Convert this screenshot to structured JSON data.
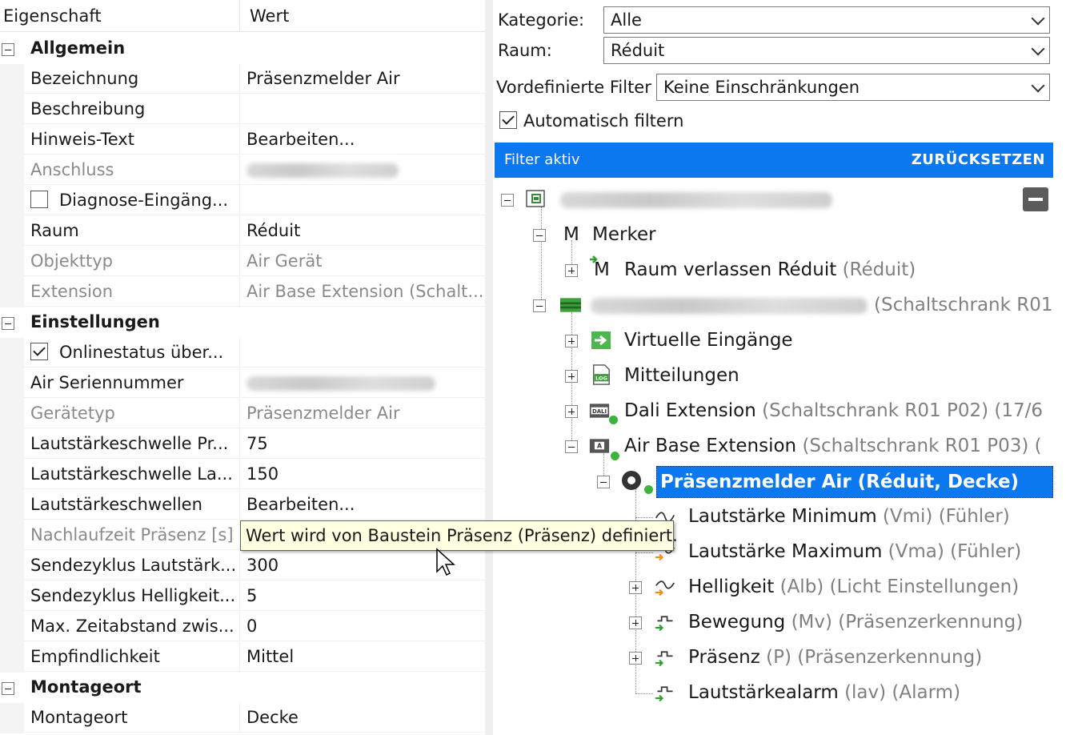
{
  "properties": {
    "header": {
      "name": "Eigenschaft",
      "value": "Wert"
    },
    "categories": {
      "allgemein": "Allgemein",
      "einstellungen": "Einstellungen",
      "montageort": "Montageort"
    },
    "rows": {
      "bezeichnung": {
        "name": "Bezeichnung",
        "value": "Präsenzmelder Air"
      },
      "beschreibung": {
        "name": "Beschreibung",
        "value": ""
      },
      "hinweis": {
        "name": "Hinweis-Text",
        "value": "Bearbeiten..."
      },
      "anschluss": {
        "name": "Anschluss"
      },
      "diagnose": {
        "name": "Diagnose-Eingäng..."
      },
      "raum": {
        "name": "Raum",
        "value": "Réduit"
      },
      "objekttyp": {
        "name": "Objekttyp",
        "value": "Air Gerät"
      },
      "extension": {
        "name": "Extension",
        "value": "Air Base Extension (Schalt..."
      },
      "onlinestatus": {
        "name": "Onlinestatus über..."
      },
      "seriennummer": {
        "name": "Air Seriennummer"
      },
      "geraetetyp": {
        "name": "Gerätetyp",
        "value": "Präsenzmelder Air"
      },
      "lautstaerke_pr": {
        "name": "Lautstärkeschwelle Pr...",
        "value": "75"
      },
      "lautstaerke_la": {
        "name": "Lautstärkeschwelle La...",
        "value": "150"
      },
      "lautstaerkeschwellen": {
        "name": "Lautstärkeschwellen",
        "value": "Bearbeiten..."
      },
      "nachlaufzeit": {
        "name": "Nachlaufzeit Präsenz [s]"
      },
      "sendezyklus_laut": {
        "name": "Sendezyklus Lautstärk...",
        "value": "300"
      },
      "sendezyklus_hell": {
        "name": "Sendezyklus Helligkeit...",
        "value": "5"
      },
      "max_zeitabstand": {
        "name": "Max. Zeitabstand zwis...",
        "value": "0"
      },
      "empfindlichkeit": {
        "name": "Empfindlichkeit",
        "value": "Mittel"
      },
      "montageort": {
        "name": "Montageort",
        "value": "Decke"
      }
    },
    "tooltip": "Wert wird von Baustein Präsenz (Präsenz) definiert."
  },
  "filter": {
    "kategorie_label": "Kategorie:",
    "kategorie_value": "Alle",
    "raum_label": "Raum:",
    "raum_value": "Réduit",
    "vordefiniert_label": "Vordefinierte Filter",
    "vordefiniert_value": "Keine Einschränkungen",
    "auto_label": "Automatisch filtern",
    "auto_checked": true,
    "banner_text": "Filter aktiv",
    "reset_label": "ZURÜCKSETZEN"
  },
  "tree": {
    "merker": "Merker",
    "merker_letter": "M",
    "raum_verlassen": "Raum verlassen Réduit",
    "raum_verlassen_sub": "(Réduit)",
    "schaltschrank_sub": "(Schaltschrank R01",
    "virtuelle": "Virtuelle Eingänge",
    "mitteilungen": "Mitteilungen",
    "dali": "Dali Extension",
    "dali_sub": "(Schaltschrank R01 P02) (17/6",
    "airbase": "Air Base Extension",
    "airbase_sub": "(Schaltschrank R01 P03) (",
    "praesenzmelder": "Präsenzmelder Air (Réduit, Decke)",
    "laut_min": "Lautstärke Minimum",
    "laut_min_sub": "(Vmi) (Fühler)",
    "laut_max": "Lautstärke Maximum",
    "laut_max_sub": "(Vma) (Fühler)",
    "helligkeit": "Helligkeit",
    "helligkeit_sub": "(Alb) (Licht Einstellungen)",
    "bewegung": "Bewegung",
    "bewegung_sub": "(Mv) (Präsenzerkennung)",
    "praesenz": "Präsenz",
    "praesenz_sub": "(P) (Präsenzerkennung)",
    "lautstaerkealarm": "Lautstärkealarm",
    "lautstaerkealarm_sub": "(lav) (Alarm)"
  }
}
